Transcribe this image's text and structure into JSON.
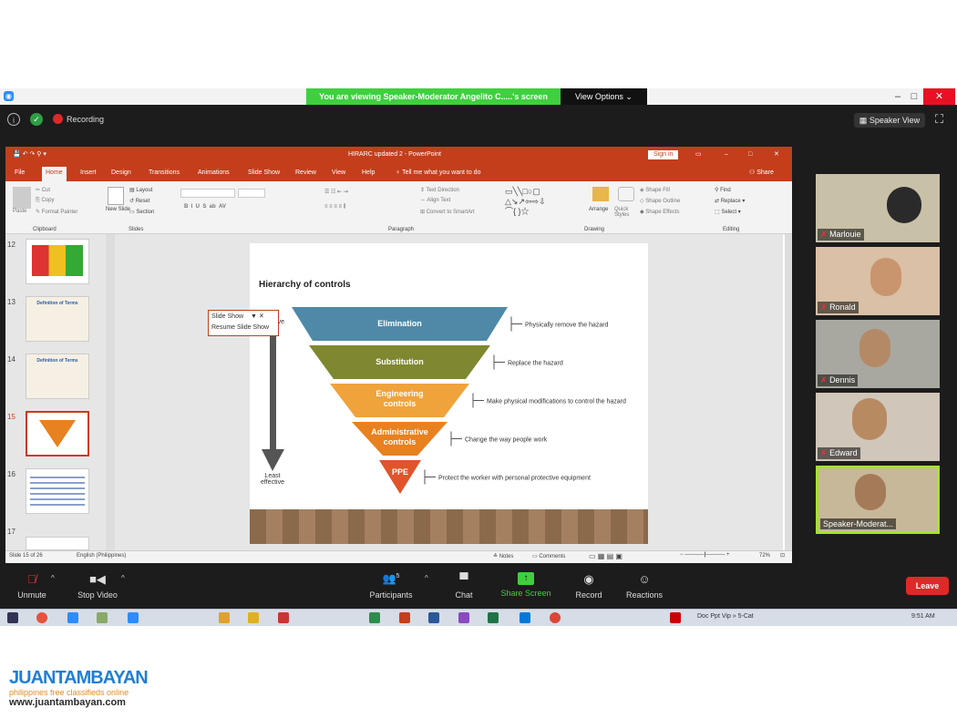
{
  "zoom": {
    "banner": "You are viewing Speaker-Moderator Angelito C.....'s screen",
    "view_options": "View Options",
    "recording": "Recording",
    "speaker_view": "Speaker View",
    "participants_count": "5",
    "controls": [
      "Unmute",
      "Stop Video",
      "Participants",
      "Chat",
      "Share Screen",
      "Record",
      "Reactions"
    ],
    "leave": "Leave",
    "participants": [
      "Marlouie",
      "Ronald",
      "Dennis",
      "Edward",
      "Speaker-Moderat..."
    ],
    "accent_green": "#3fcf3f",
    "leave_color": "#e02828"
  },
  "ppt": {
    "title": "HIRARC updated 2 - PowerPoint",
    "sign_in": "Sign in",
    "share": "Share",
    "tell_me": "Tell me what you want to do",
    "tabs": [
      "File",
      "Home",
      "Insert",
      "Design",
      "Transitions",
      "Animations",
      "Slide Show",
      "Review",
      "View",
      "Help"
    ],
    "ribbon": {
      "cut": "Cut",
      "copy": "Copy",
      "paste": "Paste",
      "format_painter": "Format Painter",
      "new_slide": "New Slide",
      "layout": "Layout",
      "reset": "Reset",
      "section": "Section",
      "text_direction": "Text Direction",
      "align_text": "Align Text",
      "smartart": "Convert to SmartArt",
      "arrange": "Arrange",
      "quick_styles": "Quick Styles",
      "shape_fill": "Shape Fill",
      "shape_outline": "Shape Outline",
      "shape_effects": "Shape Effects",
      "find": "Find",
      "replace": "Replace",
      "select": "Select",
      "groups": [
        "Clipboard",
        "Slides",
        "Paragraph",
        "Drawing",
        "Editing"
      ]
    },
    "popup": {
      "slide_show": "Slide Show",
      "resume": "Resume Slide Show"
    },
    "thumbs": [
      "12",
      "13",
      "14",
      "15",
      "16",
      "17"
    ],
    "thumb_titles": [
      "Definition of Terms",
      "Definition of Terms"
    ],
    "slide": {
      "title": "Hierarchy of controls",
      "most": "Most effective",
      "least": "Least effective",
      "levels": [
        {
          "label": "Elimination",
          "desc": "Physically remove the hazard",
          "color": "#4e8aa8"
        },
        {
          "label": "Substitution",
          "desc": "Replace the hazard",
          "color": "#7f8730"
        },
        {
          "label": "Engineering controls",
          "desc": "Make physical modifications to control the hazard",
          "color": "#f0a33a"
        },
        {
          "label": "Administrative controls",
          "desc": "Change the way people work",
          "color": "#e8811f"
        },
        {
          "label": "PPE",
          "desc": "Protect the worker with personal protective equipment",
          "color": "#e0542a"
        }
      ]
    },
    "status": {
      "slide": "Slide 15 of 26",
      "lang": "English (Philippines)",
      "notes": "Notes",
      "comments": "Comments",
      "zoom": "72%"
    }
  },
  "taskbar": {
    "tray": "Doc  Ppt  Vip  »  5-Cat",
    "time": "9:51 AM"
  },
  "watermark": {
    "brand": "JUANTAMBAYAN",
    "tagline": "philippines   free classifieds online",
    "url": "www.juantambayan.com"
  }
}
